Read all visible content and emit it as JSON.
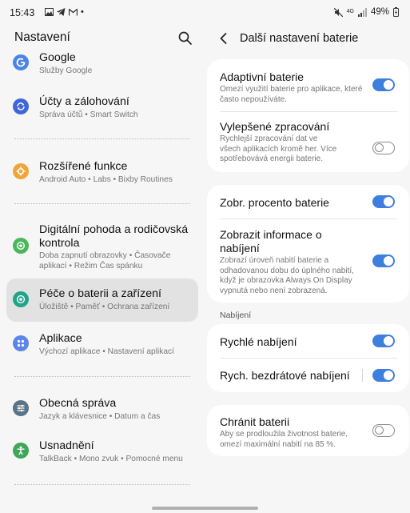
{
  "status": {
    "time": "15:43",
    "battery": "49%",
    "network": "4G"
  },
  "left": {
    "title": "Nastavení",
    "items": [
      {
        "title": "Google",
        "subtitle": "Služby Google",
        "icon": "google-icon",
        "color": "#4a84e6"
      },
      {
        "title": "Účty a zálohování",
        "subtitle": "Správa účtů  •  Smart Switch",
        "icon": "sync-icon",
        "color": "#3f67d9"
      },
      {
        "title": "Rozšířené funkce",
        "subtitle": "Android Auto  •  Labs  •  Bixby Routines",
        "icon": "advanced-features-icon",
        "color": "#f0a536"
      },
      {
        "title": "Digitální pohoda a rodičovská kontrola",
        "subtitle": "Doba zapnutí obrazovky  •  Časovače aplikací  •  Režim Čas spánku",
        "icon": "wellbeing-icon",
        "color": "#4cb65c"
      },
      {
        "title": "Péče o baterii a zařízení",
        "subtitle": "Úložiště  •  Paměť  •  Ochrana zařízení",
        "icon": "device-care-icon",
        "color": "#21a48a"
      },
      {
        "title": "Aplikace",
        "subtitle": "Výchozí aplikace  •  Nastavení aplikací",
        "icon": "apps-icon",
        "color": "#5b86e8"
      },
      {
        "title": "Obecná správa",
        "subtitle": "Jazyk a klávesnice  •  Datum a čas",
        "icon": "general-management-icon",
        "color": "#5a7386"
      },
      {
        "title": "Usnadnění",
        "subtitle": "TalkBack  •  Mono zvuk  •  Pomocné menu",
        "icon": "accessibility-icon",
        "color": "#3fa65a"
      }
    ]
  },
  "right": {
    "title": "Další nastavení baterie",
    "section_charging": "Nabíjení",
    "rows": [
      {
        "title": "Adaptivní baterie",
        "subtitle": "Omezí využití baterie pro aplikace, které často nepoužíváte.",
        "on": true
      },
      {
        "title": "Vylepšené zpracování",
        "subtitle": "Rychlejší zpracování dat ve všech aplikacích kromě her. Více spotřebovává energii baterie.",
        "on": false
      },
      {
        "title": "Zobr. procento baterie",
        "subtitle": "",
        "on": true
      },
      {
        "title": "Zobrazit informace o nabíjení",
        "subtitle": "Zobrazí úroveň nabití baterie a odhadovanou dobu do úplného nabití, když je obrazovka Always On Display vypnutá nebo není zobrazená.",
        "on": true
      },
      {
        "title": "Rychlé nabíjení",
        "subtitle": "",
        "on": true
      },
      {
        "title": "Rych. bezdrátové nabíjení",
        "subtitle": "",
        "on": true
      },
      {
        "title": "Chránit baterii",
        "subtitle": "Aby se prodloužila životnost baterie, omezí maximální nabití na 85 %.",
        "on": false
      }
    ]
  },
  "colors": {
    "accent": "#3e7ede",
    "highlight": "#e2e2e2"
  }
}
